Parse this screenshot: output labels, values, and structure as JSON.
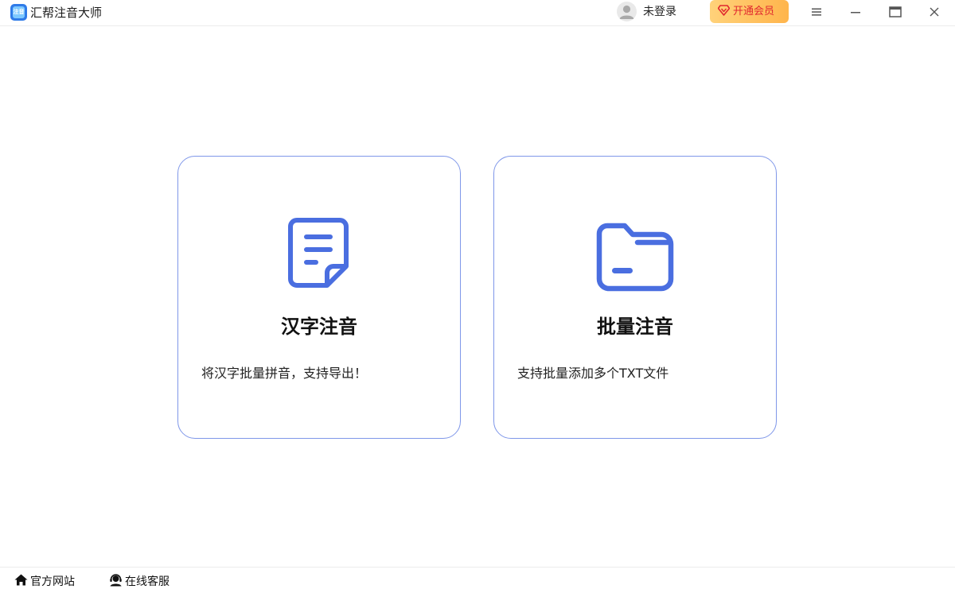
{
  "titlebar": {
    "app_title": "汇帮注音大师",
    "logo_text": "注音",
    "login_label": "未登录",
    "vip_label": "开通会员"
  },
  "cards": [
    {
      "title": "汉字注音",
      "description": "将汉字批量拼音，支持导出！",
      "icon": "document-icon"
    },
    {
      "title": "批量注音",
      "description": "支持批量添加多个TXT文件",
      "icon": "folder-icon"
    }
  ],
  "footer": {
    "website_label": "官方网站",
    "support_label": "在线客服"
  },
  "colors": {
    "accent": "#4a6ee0",
    "card_border": "#7f97e9",
    "vip_text": "#e0282f",
    "vip_bg": "#ffc15e"
  }
}
